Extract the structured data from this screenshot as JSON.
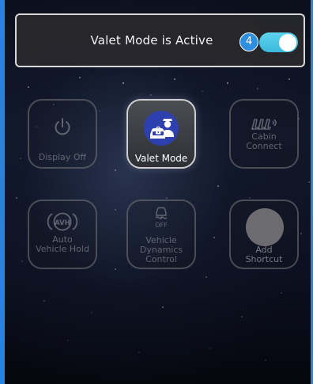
{
  "banner": {
    "text": "Valet Mode is Active",
    "count": "4",
    "toggle_state": "on"
  },
  "tiles": [
    {
      "label": "Display Off",
      "icon": "power-icon",
      "state": "disabled"
    },
    {
      "label": "Valet Mode",
      "icon": "valet-mode-icon",
      "state": "active"
    },
    {
      "label": "Cabin\nConnect",
      "icon": "cabin-connect-icon",
      "state": "disabled"
    },
    {
      "label": "Auto\nVehicle Hold",
      "icon": "avh-icon",
      "state": "disabled"
    },
    {
      "label": "Vehicle\nDynamics\nControl",
      "icon": "vehicle-dynamics-off-icon",
      "state": "disabled",
      "icon_text": "OFF"
    },
    {
      "label": "Add\nShortcut",
      "icon": "add-shortcut-circle",
      "state": "disabled"
    }
  ],
  "avh_icon_text": "AVH",
  "colors": {
    "accent": "#2e8fe0",
    "toggle_on": "#4cc6e6",
    "valet_icon_bg": "#2e3fae",
    "frame_edge": "#2b82d6"
  }
}
